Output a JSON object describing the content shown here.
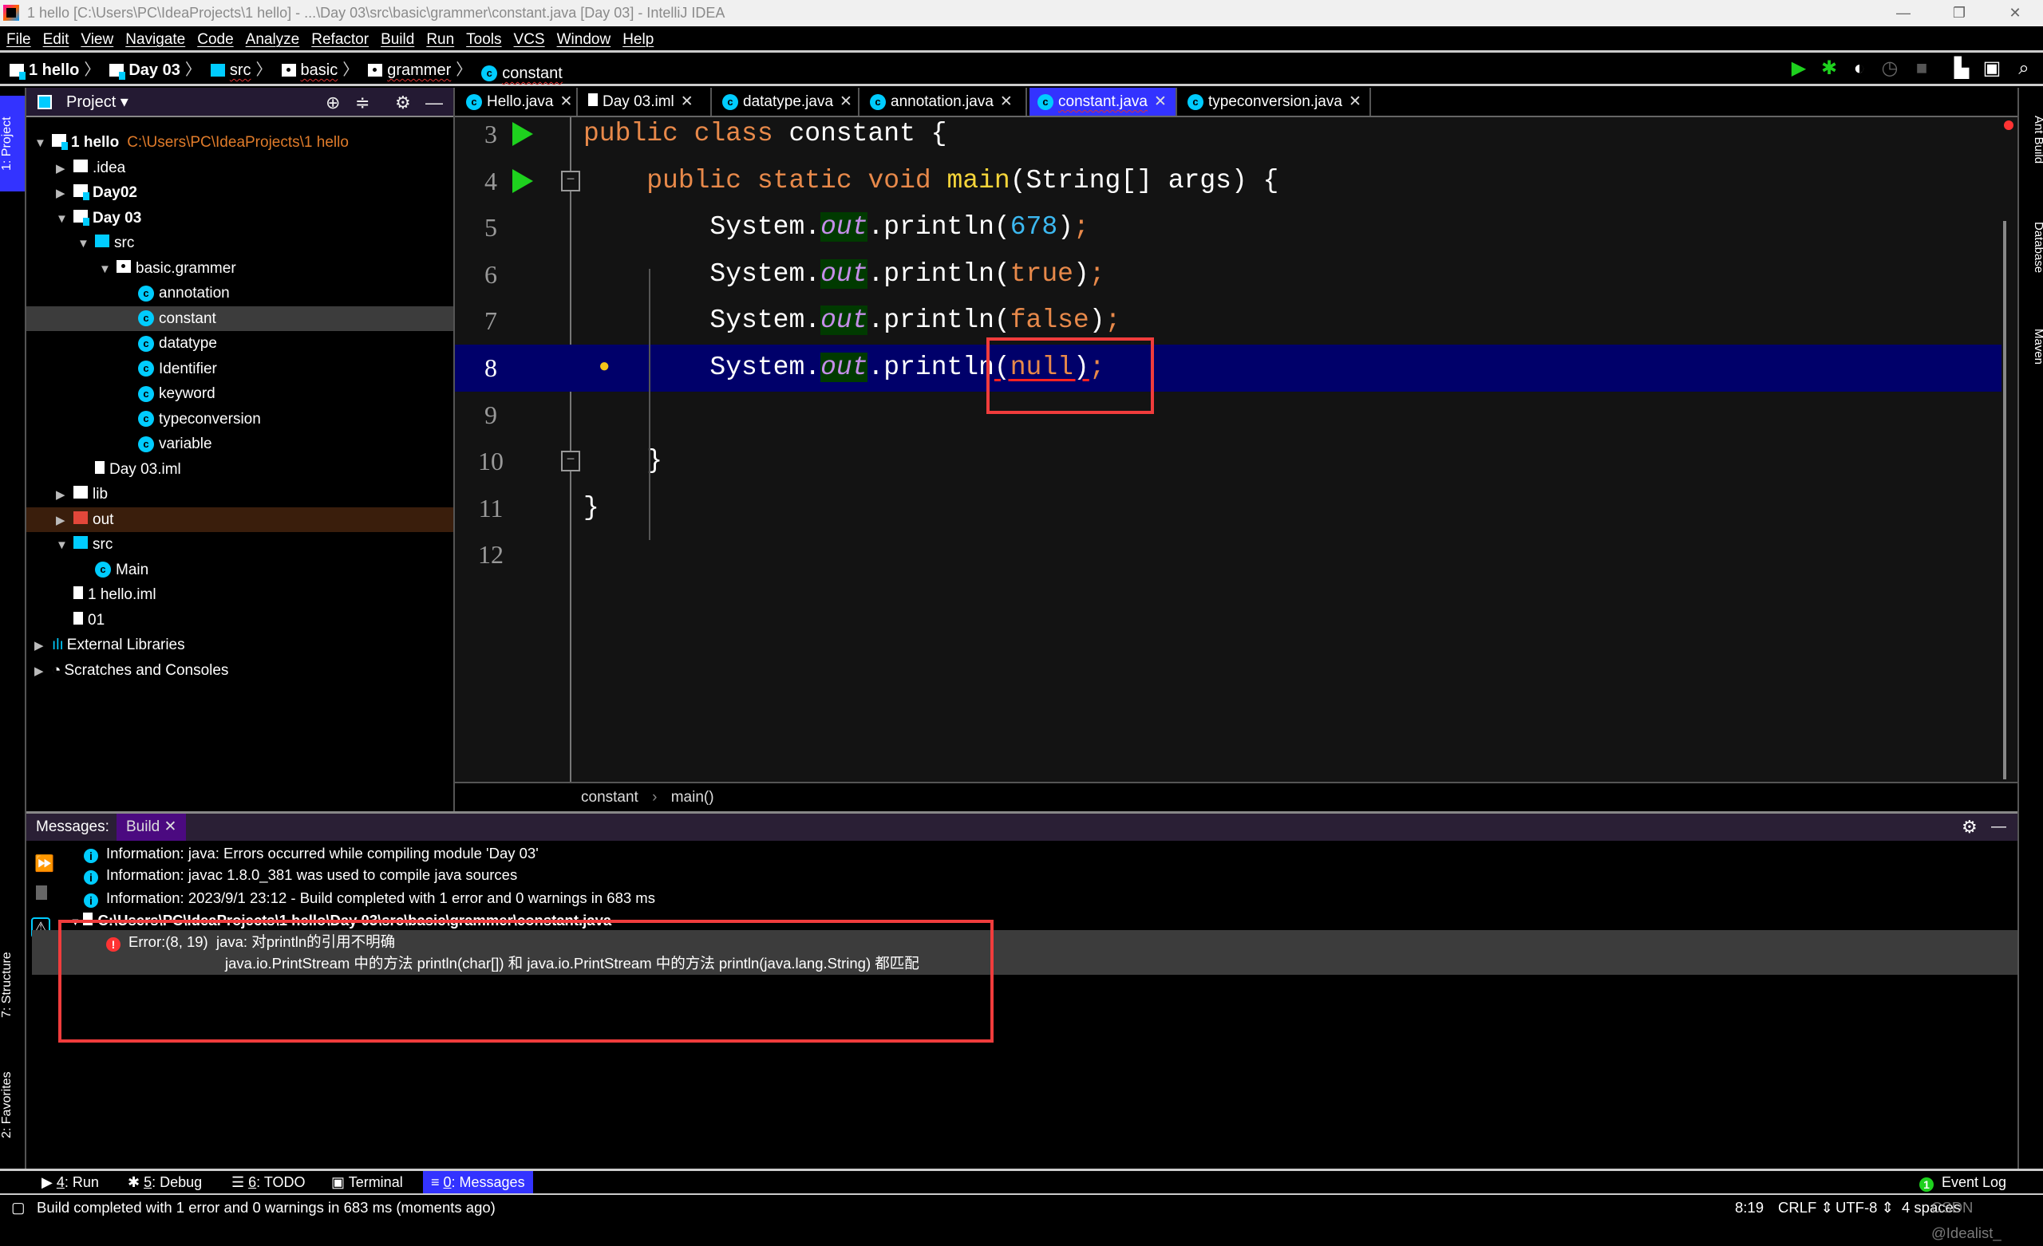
{
  "window": {
    "title": "1 hello [C:\\Users\\PC\\IdeaProjects\\1 hello] - ...\\Day 03\\src\\basic\\grammer\\constant.java [Day 03] - IntelliJ IDEA"
  },
  "menu": [
    "File",
    "Edit",
    "View",
    "Navigate",
    "Code",
    "Analyze",
    "Refactor",
    "Build",
    "Run",
    "Tools",
    "VCS",
    "Window",
    "Help"
  ],
  "nav": {
    "crumbs": [
      {
        "label": "1 hello",
        "icon": "module",
        "bold": true
      },
      {
        "label": "Day 03",
        "icon": "module",
        "bold": true
      },
      {
        "label": "src",
        "icon": "source-folder"
      },
      {
        "label": "basic",
        "icon": "package"
      },
      {
        "label": "grammer",
        "icon": "package"
      },
      {
        "label": "constant",
        "icon": "class"
      }
    ],
    "run_config": "constant"
  },
  "side_tabs": {
    "left": [
      "1: Project",
      "7: Structure",
      "2: Favorites"
    ],
    "right": [
      "Ant Build",
      "Database",
      "Maven"
    ]
  },
  "project": {
    "header": "Project",
    "tree": [
      {
        "level": 0,
        "arrow": "down",
        "icon": "module",
        "label": "1 hello",
        "bold": true,
        "hint": "C:\\Users\\PC\\IdeaProjects\\1 hello"
      },
      {
        "level": 1,
        "arrow": "right",
        "icon": "folder",
        "label": ".idea"
      },
      {
        "level": 1,
        "arrow": "right",
        "icon": "module",
        "label": "Day02",
        "bold": true
      },
      {
        "level": 1,
        "arrow": "down",
        "icon": "module",
        "label": "Day 03",
        "bold": true
      },
      {
        "level": 2,
        "arrow": "down",
        "icon": "source-folder",
        "label": "src"
      },
      {
        "level": 3,
        "arrow": "down",
        "icon": "package",
        "label": "basic.grammer"
      },
      {
        "level": 4,
        "icon": "class",
        "label": "annotation"
      },
      {
        "level": 4,
        "icon": "class",
        "label": "constant",
        "selected": true
      },
      {
        "level": 4,
        "icon": "class",
        "label": "datatype"
      },
      {
        "level": 4,
        "icon": "class",
        "label": "Identifier"
      },
      {
        "level": 4,
        "icon": "class",
        "label": "keyword"
      },
      {
        "level": 4,
        "icon": "class",
        "label": "typeconversion"
      },
      {
        "level": 4,
        "icon": "class",
        "label": "variable"
      },
      {
        "level": 2,
        "icon": "iml-file",
        "label": "Day 03.iml"
      },
      {
        "level": 1,
        "arrow": "right",
        "icon": "folder",
        "label": "lib"
      },
      {
        "level": 1,
        "arrow": "right",
        "icon": "excluded-folder",
        "label": "out",
        "excluded": true
      },
      {
        "level": 1,
        "arrow": "down",
        "icon": "source-folder",
        "label": "src"
      },
      {
        "level": 2,
        "icon": "class",
        "label": "Main"
      },
      {
        "level": 1,
        "icon": "iml-file",
        "label": "1 hello.iml"
      },
      {
        "level": 1,
        "icon": "file",
        "label": "01"
      },
      {
        "level": 0,
        "arrow": "right",
        "icon": "libraries",
        "label": "External Libraries"
      },
      {
        "level": 0,
        "arrow": "right",
        "icon": "scratches",
        "label": "Scratches and Consoles"
      }
    ]
  },
  "tabs": [
    {
      "label": "Hello.java",
      "icon": "class"
    },
    {
      "label": "Day 03.iml",
      "icon": "iml-file"
    },
    {
      "label": "datatype.java",
      "icon": "class"
    },
    {
      "label": "annotation.java",
      "icon": "class"
    },
    {
      "label": "constant.java",
      "icon": "class",
      "active": true
    },
    {
      "label": "typeconversion.java",
      "icon": "class"
    }
  ],
  "editor": {
    "lines": [
      {
        "n": "3",
        "run": true,
        "tokens": [
          [
            "kw",
            "public class "
          ],
          [
            "",
            "constant {"
          ]
        ]
      },
      {
        "n": "4",
        "run": true,
        "fold": "open",
        "tokens": [
          [
            "",
            "    "
          ],
          [
            "kw",
            "public static void "
          ],
          [
            "fn",
            "main"
          ],
          [
            "",
            "(String[] args) {"
          ]
        ]
      },
      {
        "n": "5",
        "tokens": [
          [
            "",
            "        System."
          ],
          [
            "fld",
            "out"
          ],
          [
            "",
            ".println("
          ],
          [
            "num",
            "678"
          ],
          [
            "",
            ")"
          ],
          [
            "kw",
            ";"
          ]
        ]
      },
      {
        "n": "6",
        "tokens": [
          [
            "",
            "        System."
          ],
          [
            "fld",
            "out"
          ],
          [
            "",
            ".println("
          ],
          [
            "kw",
            "true"
          ],
          [
            "",
            ")"
          ],
          [
            "kw",
            ";"
          ]
        ]
      },
      {
        "n": "7",
        "tokens": [
          [
            "",
            "        System."
          ],
          [
            "fld",
            "out"
          ],
          [
            "",
            ".println("
          ],
          [
            "kw",
            "false"
          ],
          [
            "",
            ")"
          ],
          [
            "kw",
            ";"
          ]
        ]
      },
      {
        "n": "8",
        "current": true,
        "bulb": true,
        "tokens": [
          [
            "",
            "        System."
          ],
          [
            "fld",
            "out"
          ],
          [
            "",
            ".println"
          ],
          [
            "err",
            "("
          ],
          [
            "kw err",
            "null"
          ],
          [
            "err",
            ")"
          ],
          [
            "kw",
            ";"
          ]
        ]
      },
      {
        "n": "9",
        "tokens": []
      },
      {
        "n": "10",
        "fold": "close",
        "tokens": [
          [
            "",
            "    }"
          ]
        ]
      },
      {
        "n": "11",
        "tokens": [
          [
            "",
            "}"
          ]
        ]
      },
      {
        "n": "12",
        "tokens": []
      }
    ],
    "breadcrumb": [
      "constant",
      "main()"
    ]
  },
  "messages": {
    "label": "Messages:",
    "tab": "Build",
    "lines": [
      {
        "type": "info",
        "text": "Information: java: Errors occurred while compiling module 'Day 03'"
      },
      {
        "type": "info",
        "text": "Information: javac 1.8.0_381 was used to compile java sources"
      },
      {
        "type": "info",
        "text": "Information: 2023/9/1 23:12 - Build completed with 1 error and 0 warnings in 683 ms"
      },
      {
        "type": "file",
        "text": "C:\\Users\\PC\\IdeaProjects\\1 hello\\Day 03\\src\\basic\\grammer\\constant.java"
      },
      {
        "type": "error",
        "text": "Error:(8, 19)  java: 对println的引用不明确"
      },
      {
        "type": "detail",
        "text": "java.io.PrintStream 中的方法 println(char[]) 和 java.io.PrintStream 中的方法 println(java.lang.String) 都匹配"
      }
    ]
  },
  "tool_windows": [
    {
      "key": "4",
      "label": ": Run",
      "icon": "run"
    },
    {
      "key": "5",
      "label": ": Debug",
      "icon": "bug"
    },
    {
      "key": "6",
      "label": ": TODO",
      "icon": "list"
    },
    {
      "key": "",
      "label": "Terminal",
      "icon": "terminal"
    },
    {
      "key": "0",
      "label": ": Messages",
      "icon": "messages",
      "active": true
    }
  ],
  "event_log": {
    "count": "1",
    "label": "Event Log"
  },
  "status": {
    "message": "Build completed with 1 error and 0 warnings in 683 ms (moments ago)",
    "position": "8:19",
    "line_sep": "CRLF",
    "encoding": "UTF-8",
    "indent": "4 spaces",
    "watermark": "CSDN @Idealist_"
  },
  "colors": {
    "accent": "#3333ff",
    "keyword": "#e8894a",
    "number": "#3cb8f0",
    "error": "#f03c3c",
    "run": "#1ed11e"
  }
}
